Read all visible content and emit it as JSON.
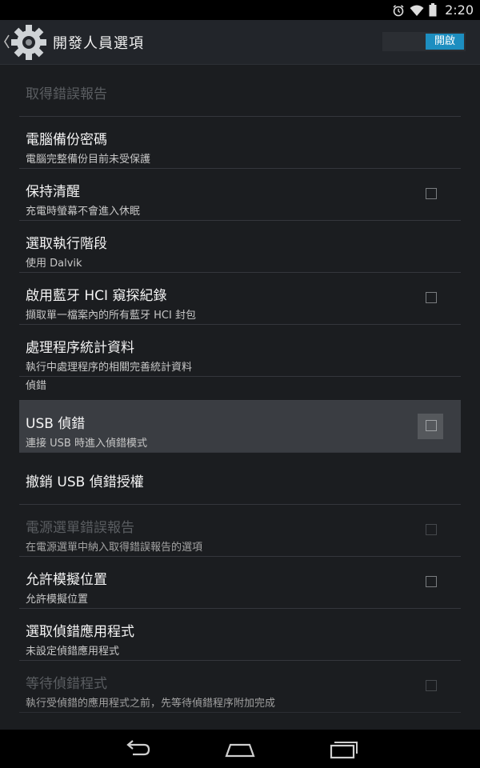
{
  "status_bar": {
    "time": "2:20"
  },
  "action_bar": {
    "title": "開發人員選項",
    "switch_label": "開啟"
  },
  "items": [
    {
      "title": "取得錯誤報告",
      "summary": ""
    },
    {
      "title": "電腦備份密碼",
      "summary": "電腦完整備份目前未受保護"
    },
    {
      "title": "保持清醒",
      "summary": "充電時螢幕不會進入休眠"
    },
    {
      "title": "選取執行階段",
      "summary": "使用 Dalvik"
    },
    {
      "title": "啟用藍牙 HCI 窺探紀錄",
      "summary": "擷取單一檔案內的所有藍牙 HCI 封包"
    },
    {
      "title": "處理程序統計資料",
      "summary": "執行中處理程序的相關完善統計資料"
    }
  ],
  "section_debug": {
    "label": "偵錯"
  },
  "debug_items": [
    {
      "title": "USB 偵錯",
      "summary": "連接 USB 時進入偵錯模式"
    },
    {
      "title": "撤銷 USB 偵錯授權",
      "summary": ""
    },
    {
      "title": "電源選單錯誤報告",
      "summary": "在電源選單中納入取得錯誤報告的選項"
    },
    {
      "title": "允許模擬位置",
      "summary": "允許模擬位置"
    },
    {
      "title": "選取偵錯應用程式",
      "summary": "未設定偵錯應用程式"
    },
    {
      "title": "等待偵錯程式",
      "summary": "執行受偵錯的應用程式之前，先等待偵錯程序附加完成"
    }
  ],
  "colors": {
    "accent": "#1d8ec0",
    "background": "#1b1d20",
    "highlight": "#3a3d42"
  }
}
